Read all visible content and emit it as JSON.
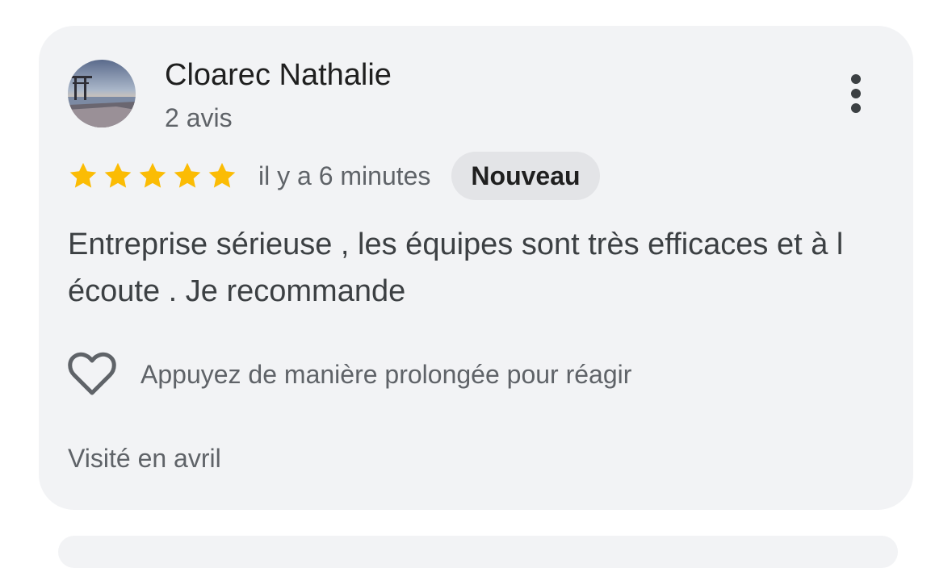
{
  "review": {
    "author": {
      "name": "Cloarec Nathalie",
      "review_count": "2 avis"
    },
    "rating": {
      "stars": 5,
      "max_stars": 5,
      "star_color": "#fbbc04"
    },
    "timestamp": "il y a 6 minutes",
    "badge": "Nouveau",
    "text": "Entreprise sérieuse , les équipes sont très efficaces et à l écoute . Je recommande",
    "reaction_hint": "Appuyez de manière prolongée pour réagir",
    "visited": "Visité en avril",
    "icons": {
      "more": "more-vert-icon",
      "react": "heart-outline-icon"
    }
  }
}
